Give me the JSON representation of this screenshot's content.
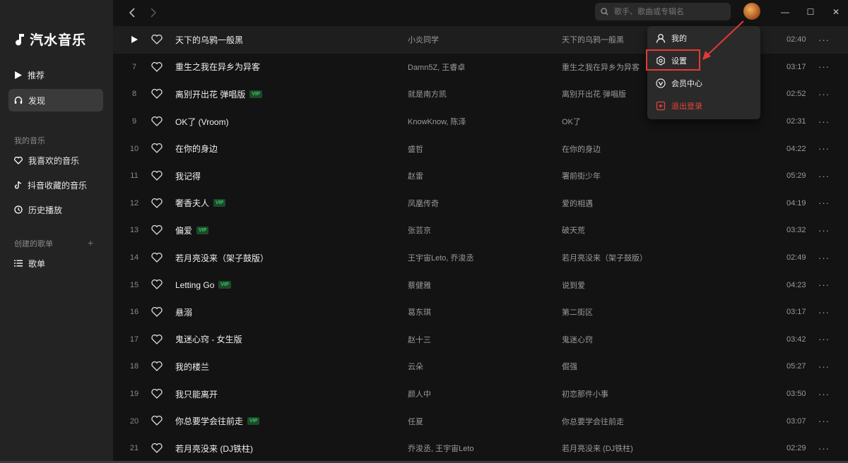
{
  "app": {
    "name": "汽水音乐"
  },
  "sidebar": {
    "nav": [
      {
        "label": "推荐",
        "icon": "play-triangle-icon"
      },
      {
        "label": "发现",
        "icon": "headphones-icon",
        "active": true
      }
    ],
    "my_music_label": "我的音乐",
    "my_music": [
      {
        "label": "我喜欢的音乐",
        "icon": "heart-icon"
      },
      {
        "label": "抖音收藏的音乐",
        "icon": "tiktok-icon"
      },
      {
        "label": "历史播放",
        "icon": "clock-icon"
      }
    ],
    "playlists_label": "创建的歌单",
    "playlists": [
      {
        "label": "歌单",
        "icon": "list-icon"
      }
    ]
  },
  "topbar": {
    "search_placeholder": "歌手、歌曲或专辑名"
  },
  "songs": [
    {
      "index": "",
      "title": "天下的乌鸦一般黑",
      "vip": false,
      "artist": "小炎同学",
      "album": "天下的乌鸦一般黑",
      "duration": "02:40"
    },
    {
      "index": "7",
      "title": "重生之我在异乡为异客",
      "vip": false,
      "artist": "Damn5Z, 王睿卓",
      "album": "重生之我在异乡为异客",
      "duration": "03:17"
    },
    {
      "index": "8",
      "title": "离别开出花 弹唱版",
      "vip": true,
      "artist": "就是南方凯",
      "album": "离别开出花 弹唱版",
      "duration": "02:52"
    },
    {
      "index": "9",
      "title": "OK了 (Vroom)",
      "vip": false,
      "artist": "KnowKnow, 陈泽",
      "album": "OK了",
      "duration": "02:31"
    },
    {
      "index": "10",
      "title": "在你的身边",
      "vip": false,
      "artist": "盛哲",
      "album": "在你的身边",
      "duration": "04:22"
    },
    {
      "index": "11",
      "title": "我记得",
      "vip": false,
      "artist": "赵雷",
      "album": "署前街少年",
      "duration": "05:29"
    },
    {
      "index": "12",
      "title": "奢香夫人",
      "vip": true,
      "artist": "凤凰传奇",
      "album": "爱的相遇",
      "duration": "04:19"
    },
    {
      "index": "13",
      "title": "偏爱",
      "vip": true,
      "artist": "张芸京",
      "album": "破天荒",
      "duration": "03:32"
    },
    {
      "index": "14",
      "title": "若月亮没来（架子鼓版）",
      "vip": false,
      "artist": "王宇宙Leto, 乔浚丞",
      "album": "若月亮没来（架子鼓版）",
      "duration": "02:49"
    },
    {
      "index": "15",
      "title": "Letting Go",
      "vip": true,
      "artist": "蔡健雅",
      "album": "说到爱",
      "duration": "04:23"
    },
    {
      "index": "16",
      "title": "悬溺",
      "vip": false,
      "artist": "葛东琪",
      "album": "第二街区",
      "duration": "03:17"
    },
    {
      "index": "17",
      "title": "鬼迷心窍 - 女生版",
      "vip": false,
      "artist": "赵十三",
      "album": "鬼迷心窍",
      "duration": "03:42"
    },
    {
      "index": "18",
      "title": "我的楼兰",
      "vip": false,
      "artist": "云朵",
      "album": "倔强",
      "duration": "05:27"
    },
    {
      "index": "19",
      "title": "我只能离开",
      "vip": false,
      "artist": "颜人中",
      "album": "初恋那件小事",
      "duration": "03:50"
    },
    {
      "index": "20",
      "title": "你总要学会往前走",
      "vip": true,
      "artist": "任夏",
      "album": "你总要学会往前走",
      "duration": "03:07"
    },
    {
      "index": "21",
      "title": "若月亮没来 (DJ铁柱)",
      "vip": false,
      "artist": "乔浚丞, 王宇宙Leto",
      "album": "若月亮没来 (DJ铁柱)",
      "duration": "02:29"
    }
  ],
  "vip_badge": "VIP",
  "user_menu": {
    "items": [
      {
        "label": "我的",
        "icon": "user-icon"
      },
      {
        "label": "设置",
        "icon": "settings-icon"
      },
      {
        "label": "会员中心",
        "icon": "vip-icon"
      },
      {
        "label": "退出登录",
        "icon": "logout-icon"
      }
    ]
  },
  "colors": {
    "accent": "#e53935",
    "vip": "#3cc46c",
    "logout": "#e5433b"
  }
}
